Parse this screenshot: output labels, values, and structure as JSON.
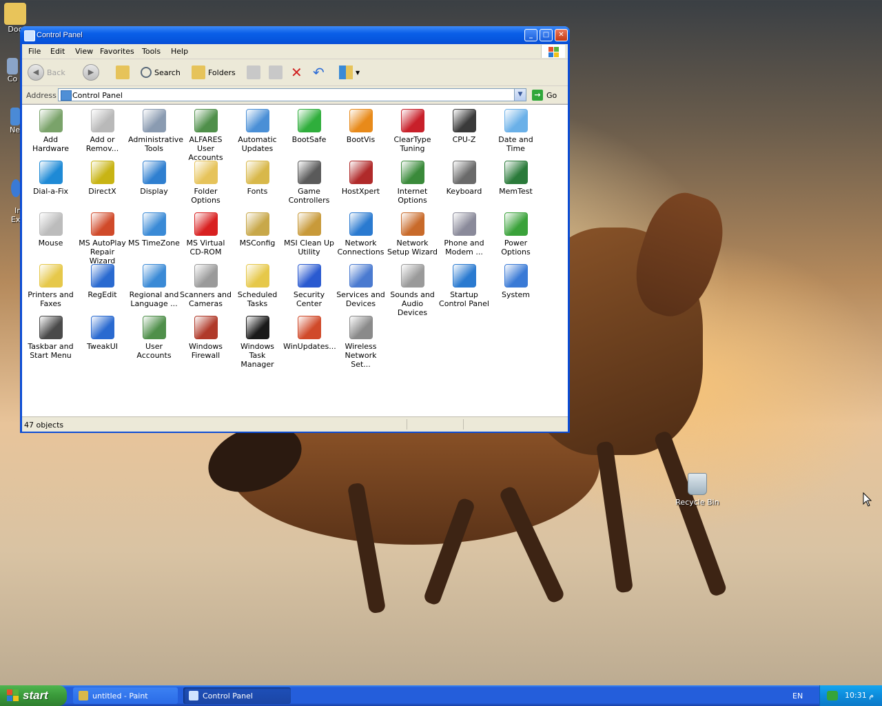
{
  "window": {
    "title": "Control Panel",
    "controls": {
      "minimize": "_",
      "maximize": "□",
      "close": "✕"
    }
  },
  "menu": [
    "File",
    "Edit",
    "View",
    "Favorites",
    "Tools",
    "Help"
  ],
  "toolbar": {
    "back_label": "Back",
    "search_label": "Search",
    "folders_label": "Folders"
  },
  "address": {
    "label": "Address",
    "value": "Control Panel",
    "go_label": "Go"
  },
  "items": [
    {
      "label": "Add Hardware",
      "icon": "add-hardware-icon",
      "color": "#7aa36a"
    },
    {
      "label": "Add or Remov...",
      "icon": "add-remove-programs-icon",
      "color": "#b9b9b9"
    },
    {
      "label": "Administrative Tools",
      "icon": "administrative-tools-icon",
      "color": "#8a9bb1"
    },
    {
      "label": "ALFARES User Accounts",
      "icon": "user-accounts-icon",
      "color": "#4f8f4a"
    },
    {
      "label": "Automatic Updates",
      "icon": "automatic-updates-icon",
      "color": "#4a8fd6"
    },
    {
      "label": "BootSafe",
      "icon": "bootsafe-icon",
      "color": "#2fae3c"
    },
    {
      "label": "BootVis",
      "icon": "bootvis-icon",
      "color": "#e88a1a"
    },
    {
      "label": "ClearType Tuning",
      "icon": "cleartype-icon",
      "color": "#c8202a"
    },
    {
      "label": "CPU-Z",
      "icon": "cpu-z-icon",
      "color": "#3a3a3a"
    },
    {
      "label": "Date and Time",
      "icon": "date-time-icon",
      "color": "#6ab0e8"
    },
    {
      "label": "Dial-a-Fix",
      "icon": "dial-a-fix-icon",
      "color": "#1e8ad6"
    },
    {
      "label": "DirectX",
      "icon": "directx-icon",
      "color": "#c8b414"
    },
    {
      "label": "Display",
      "icon": "display-icon",
      "color": "#2f7fd0"
    },
    {
      "label": "Folder Options",
      "icon": "folder-options-icon",
      "color": "#e6c35a"
    },
    {
      "label": "Fonts",
      "icon": "fonts-icon",
      "color": "#d8b84a"
    },
    {
      "label": "Game Controllers",
      "icon": "game-controllers-icon",
      "color": "#5a5a5a"
    },
    {
      "label": "HostXpert",
      "icon": "hostxpert-icon",
      "color": "#b02a2a"
    },
    {
      "label": "Internet Options",
      "icon": "internet-options-icon",
      "color": "#3a8a3a"
    },
    {
      "label": "Keyboard",
      "icon": "keyboard-icon",
      "color": "#6a6a6a"
    },
    {
      "label": "MemTest",
      "icon": "memtest-icon",
      "color": "#2a7a3a"
    },
    {
      "label": "Mouse",
      "icon": "mouse-icon",
      "color": "#bcbcbc"
    },
    {
      "label": "MS AutoPlay Repair Wizard",
      "icon": "autoplay-repair-icon",
      "color": "#d04a2a"
    },
    {
      "label": "MS TimeZone",
      "icon": "timezone-icon",
      "color": "#3a8ad6"
    },
    {
      "label": "MS Virtual CD-ROM",
      "icon": "virtual-cdrom-icon",
      "color": "#d82020"
    },
    {
      "label": "MSConfig",
      "icon": "msconfig-icon",
      "color": "#c8a84a"
    },
    {
      "label": "MSI Clean Up Utility",
      "icon": "msi-cleanup-icon",
      "color": "#c89a3a"
    },
    {
      "label": "Network Connections",
      "icon": "network-connections-icon",
      "color": "#2a7ad0"
    },
    {
      "label": "Network Setup Wizard",
      "icon": "network-setup-icon",
      "color": "#c86a2a"
    },
    {
      "label": "Phone and Modem ...",
      "icon": "phone-modem-icon",
      "color": "#8a8a9a"
    },
    {
      "label": "Power Options",
      "icon": "power-options-icon",
      "color": "#3aa23a"
    },
    {
      "label": "Printers and Faxes",
      "icon": "printers-faxes-icon",
      "color": "#e6c84a"
    },
    {
      "label": "RegEdit",
      "icon": "regedit-icon",
      "color": "#2a6ad0"
    },
    {
      "label": "Regional and Language ...",
      "icon": "regional-language-icon",
      "color": "#3a8ad6"
    },
    {
      "label": "Scanners and Cameras",
      "icon": "scanners-cameras-icon",
      "color": "#9a9a9a"
    },
    {
      "label": "Scheduled Tasks",
      "icon": "scheduled-tasks-icon",
      "color": "#e6c84a"
    },
    {
      "label": "Security Center",
      "icon": "security-center-icon",
      "color": "#2a5ad0"
    },
    {
      "label": "Services and Devices",
      "icon": "services-devices-icon",
      "color": "#4a7ad0"
    },
    {
      "label": "Sounds and Audio Devices",
      "icon": "sounds-audio-icon",
      "color": "#9a9a9a"
    },
    {
      "label": "Startup Control Panel",
      "icon": "startup-control-panel-icon",
      "color": "#2a7ad0"
    },
    {
      "label": "System",
      "icon": "system-icon",
      "color": "#3a7ad6"
    },
    {
      "label": "Taskbar and Start Menu",
      "icon": "taskbar-start-menu-icon",
      "color": "#4a4a4a"
    },
    {
      "label": "TweakUI",
      "icon": "tweakui-icon",
      "color": "#2a6ad0"
    },
    {
      "label": "User Accounts",
      "icon": "user-accounts-2-icon",
      "color": "#4f8f4a"
    },
    {
      "label": "Windows Firewall",
      "icon": "windows-firewall-icon",
      "color": "#b03a2a"
    },
    {
      "label": "Windows Task Manager",
      "icon": "task-manager-icon",
      "color": "#1a1a1a"
    },
    {
      "label": "WinUpdates...",
      "icon": "winupdates-icon",
      "color": "#d04a2a"
    },
    {
      "label": "Wireless Network Set...",
      "icon": "wireless-network-icon",
      "color": "#8a8a8a"
    }
  ],
  "status": {
    "text": "47 objects"
  },
  "desktop": {
    "recycle_bin": "Recycle Bin",
    "left_icons": [
      "Doc",
      "Co",
      "Ne",
      "In\nEx"
    ]
  },
  "taskbar": {
    "start_label": "start",
    "tasks": [
      "untitled - Paint",
      "Control Panel"
    ],
    "language": "EN",
    "clock": "10:31  م"
  }
}
